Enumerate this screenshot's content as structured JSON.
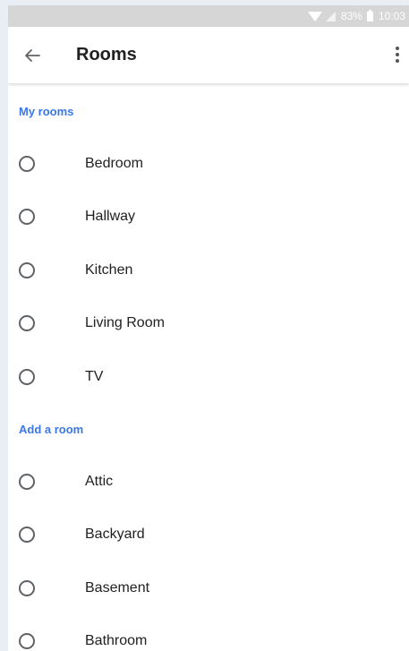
{
  "status_bar": {
    "battery": "83%",
    "time": "10:03"
  },
  "app_bar": {
    "title": "Rooms"
  },
  "sections": [
    {
      "header": "My rooms",
      "items": [
        {
          "label": "Bedroom"
        },
        {
          "label": "Hallway"
        },
        {
          "label": "Kitchen"
        },
        {
          "label": "Living Room"
        },
        {
          "label": "TV"
        }
      ]
    },
    {
      "header": "Add a room",
      "items": [
        {
          "label": "Attic"
        },
        {
          "label": "Backyard"
        },
        {
          "label": "Basement"
        },
        {
          "label": "Bathroom"
        }
      ]
    }
  ],
  "colors": {
    "accent": "#3b78e7",
    "status_bar": "#d6d6d6",
    "text": "#212121"
  },
  "icons": {
    "back": "arrow-left-icon",
    "more": "more-vert-icon",
    "radio": "radio-unchecked-icon"
  }
}
